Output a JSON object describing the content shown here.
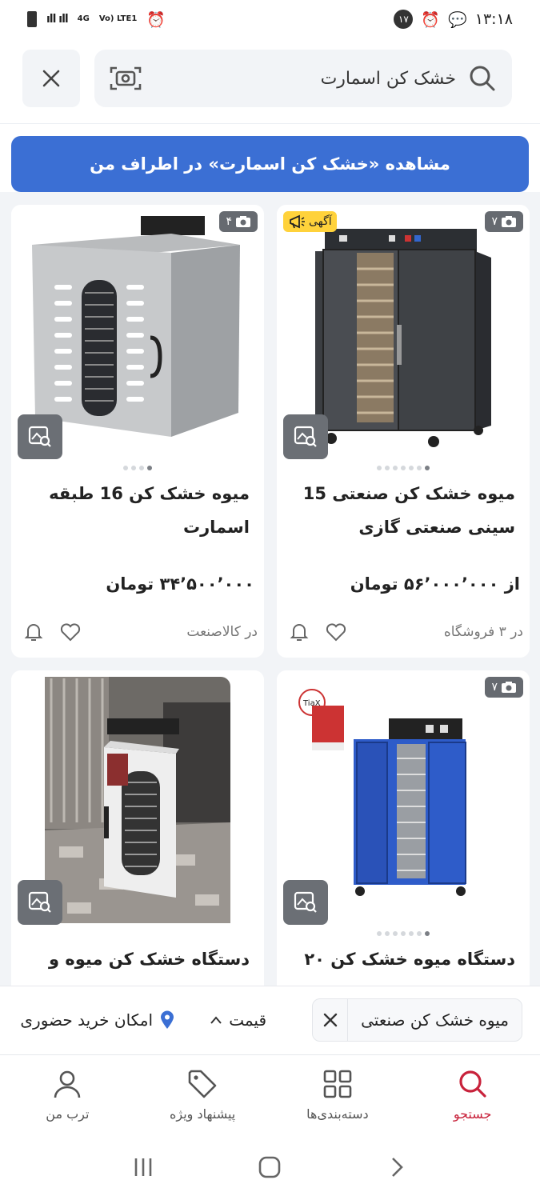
{
  "status": {
    "time": "۱۳:۱۸",
    "notification_count": "۱۷",
    "network": "4G",
    "network2": "Vo) LTE1"
  },
  "search": {
    "query": "خشک کن اسمارت"
  },
  "nearby_button": "مشاهده «خشک کن اسمارت» در اطراف من",
  "products": [
    {
      "title": "میوه خشک کن صنعتی 15 سینی صنعتی گازی",
      "price": "از ۵۶٬۰۰۰٬۰۰۰ تومان",
      "shop": "در ۳ فروشگاه",
      "photo_count": "۷",
      "ad_label": "آگهی"
    },
    {
      "title": "میوه خشک کن 16 طبقه اسمارت",
      "price": "۳۴٬۵۰۰٬۰۰۰ تومان",
      "shop": "در کالاصنعت",
      "photo_count": "۴"
    },
    {
      "title": "دستگاه میوه خشک کن ۲۰",
      "photo_count": "۷"
    },
    {
      "title": "دستگاه خشک کن میوه و"
    }
  ],
  "filters": {
    "active_chip": "میوه خشک کن صنعتی",
    "price": "قیمت",
    "in_person": "امکان خرید حضوری"
  },
  "nav": {
    "search": "جستجو",
    "categories": "دسته‌بندی‌ها",
    "offers": "پیشنهاد ویژه",
    "profile": "ترب من"
  },
  "colors": {
    "primary_blue": "#3b6fd4",
    "active_red": "#c8223b",
    "ad_yellow": "#ffd23b"
  }
}
